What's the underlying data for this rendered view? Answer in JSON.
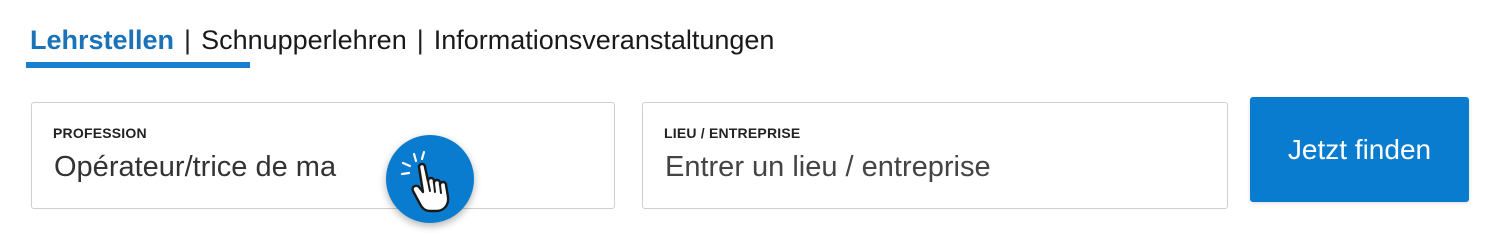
{
  "tabs": [
    {
      "label": "Lehrstellen",
      "active": true
    },
    {
      "label": "Schnupperlehren",
      "active": false
    },
    {
      "label": "Informationsveranstaltungen",
      "active": false
    }
  ],
  "separator": "|",
  "profession": {
    "label": "PROFESSION",
    "value": "Opérateur/trice de ma"
  },
  "location": {
    "label": "LIEU / ENTREPRISE",
    "placeholder": "Entrer un lieu / entreprise"
  },
  "search_button": {
    "label": "Jetzt finden"
  },
  "colors": {
    "accent": "#0a7ccf",
    "active_tab": "#1a73b8",
    "border": "#cfcfcf"
  },
  "icons": {
    "pointer": "pointing-hand-icon"
  }
}
